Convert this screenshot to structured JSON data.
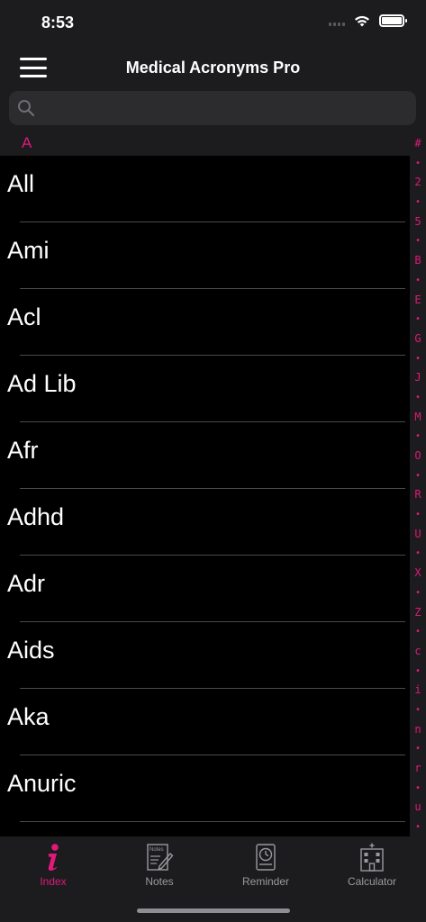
{
  "status": {
    "time": "8:53"
  },
  "nav": {
    "title": "Medical Acronyms Pro"
  },
  "search": {
    "placeholder": ""
  },
  "section": {
    "letter": "A"
  },
  "rows": [
    "All",
    "Ami",
    "Acl",
    "Ad Lib",
    "Afr",
    "Adhd",
    "Adr",
    "Aids",
    "Aka",
    "Anuric"
  ],
  "index": [
    "#",
    "•",
    "2",
    "•",
    "5",
    "•",
    "B",
    "•",
    "E",
    "•",
    "G",
    "•",
    "J",
    "•",
    "M",
    "•",
    "O",
    "•",
    "R",
    "•",
    "U",
    "•",
    "X",
    "•",
    "Z",
    "•",
    "c",
    "•",
    "i",
    "•",
    "n",
    "•",
    "r",
    "•",
    "u",
    "•"
  ],
  "tabs": {
    "index": "Index",
    "notes": "Notes",
    "notes_icon_text": "Notes",
    "reminder": "Reminder",
    "calculator": "Calculator"
  },
  "colors": {
    "accent": "#e0197a",
    "bar": "#1c1c1e",
    "background": "#000000"
  }
}
